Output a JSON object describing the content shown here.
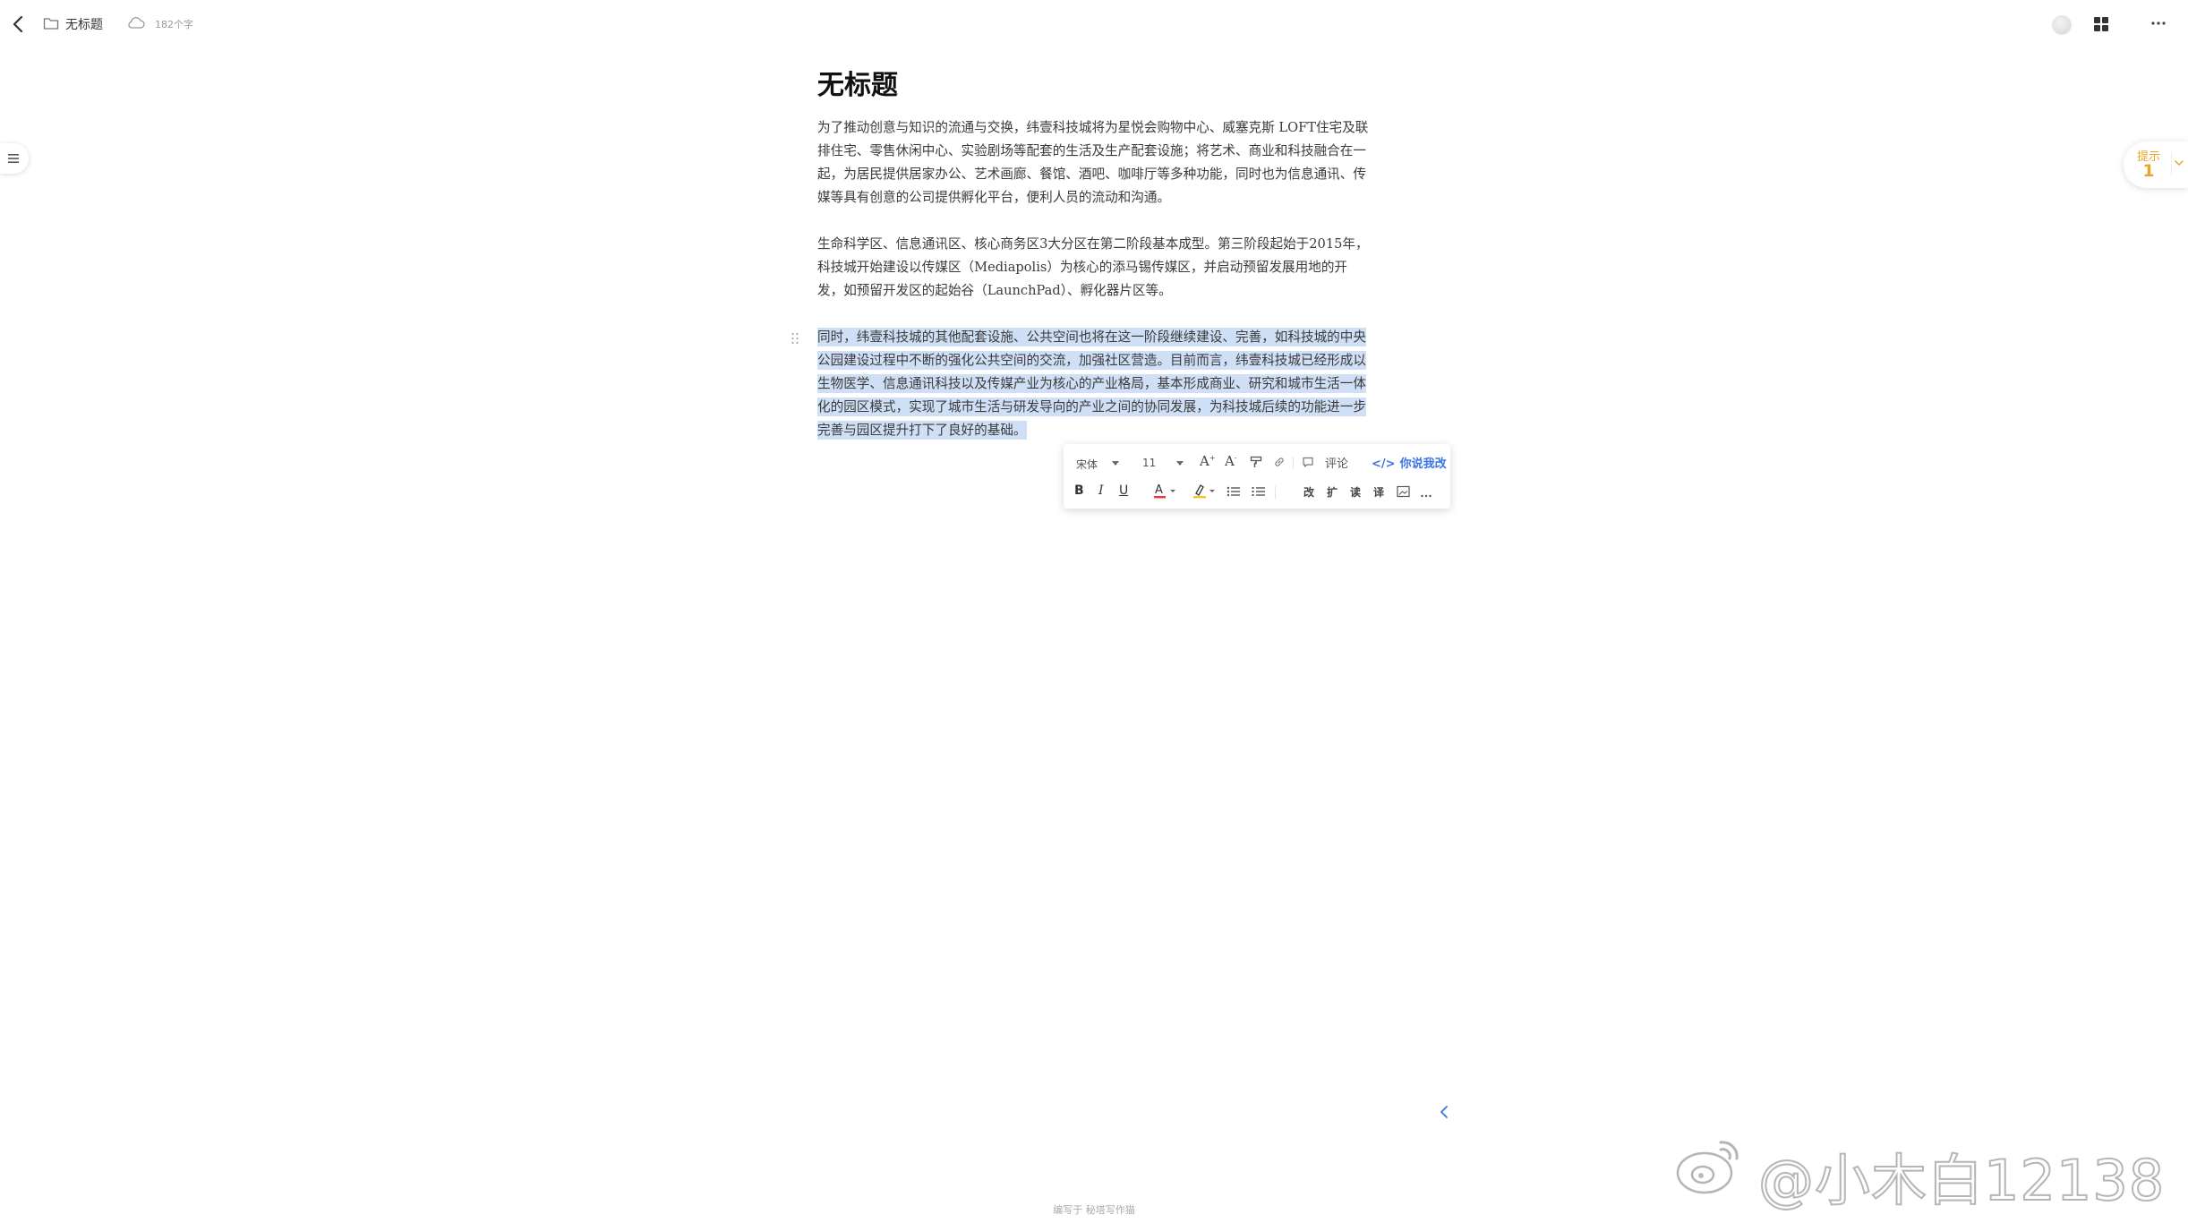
{
  "topbar": {
    "doc_name": "无标题",
    "word_count": "182个字"
  },
  "hint": {
    "label": "提示",
    "count": "1"
  },
  "document": {
    "title": "无标题",
    "paragraphs": [
      "为了推动创意与知识的流通与交换，纬壹科技城将为星悦会购物中心、威塞克斯 LOFT住宅及联排住宅、零售休闲中心、实验剧场等配套的生活及生产配套设施；将艺术、商业和科技融合在一起，为居民提供居家办公、艺术画廊、餐馆、酒吧、咖啡厅等多种功能，同时也为信息通讯、传媒等具有创意的公司提供孵化平台，便利人员的流动和沟通。",
      "生命科学区、信息通讯区、核心商务区3大分区在第二阶段基本成型。第三阶段起始于2015年，科技城开始建设以传媒区（Mediapolis）为核心的添马锡传媒区，并启动预留发展用地的开发，如预留开发区的起始谷（LaunchPad）、孵化器片区等。",
      "同时，纬壹科技城的其他配套设施、公共空间也将在这一阶段继续建设、完善，如科技城的中央公园建设过程中不断的强化公共空间的交流，加强社区营造。目前而言，纬壹科技城已经形成以生物医学、信息通讯科技以及传媒产业为核心的产业格局，基本形成商业、研究和城市生活一体化的园区模式，实现了城市生活与研发导向的产业之间的协同发展，为科技城后续的功能进一步完善与园区提升打下了良好的基础。"
    ]
  },
  "toolbar": {
    "font_family": "宋体",
    "font_size": "11",
    "comment_label": "评论",
    "ai_label": "你说我改",
    "quick_actions": [
      "改",
      "扩",
      "读",
      "译"
    ]
  },
  "footer": {
    "note": "编写于 秘塔写作猫"
  },
  "watermark": {
    "text": "@小木白12138"
  },
  "colors": {
    "selection": "#cfdff5",
    "accent_blue": "#3b74e6",
    "hint_orange": "#e8a52a",
    "font_color_bar": "#e53935",
    "highlight_bar": "#f5c518"
  }
}
